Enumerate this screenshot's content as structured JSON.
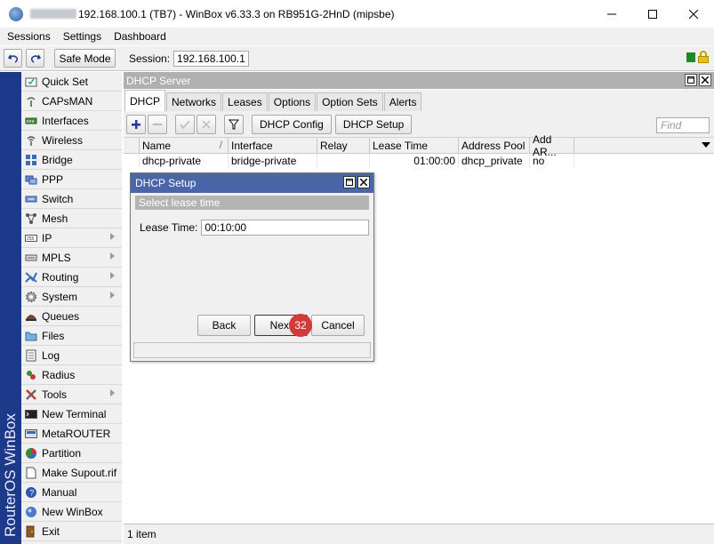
{
  "window": {
    "title": "192.168.100.1 (TB7) - WinBox v6.33.3 on RB951G-2HnD (mipsbe)"
  },
  "menubar": {
    "items": [
      "Sessions",
      "Settings",
      "Dashboard"
    ]
  },
  "toolbar": {
    "safe_mode_label": "Safe Mode",
    "session_label": "Session:",
    "session_value": "192.168.100.1"
  },
  "sidebar": {
    "brand": "RouterOS WinBox",
    "items": [
      {
        "label": "Quick Set",
        "icon": "quickset-icon",
        "submenu": false
      },
      {
        "label": "CAPsMAN",
        "icon": "capsman-icon",
        "submenu": false
      },
      {
        "label": "Interfaces",
        "icon": "interfaces-icon",
        "submenu": false
      },
      {
        "label": "Wireless",
        "icon": "wireless-icon",
        "submenu": false
      },
      {
        "label": "Bridge",
        "icon": "bridge-icon",
        "submenu": false
      },
      {
        "label": "PPP",
        "icon": "ppp-icon",
        "submenu": false
      },
      {
        "label": "Switch",
        "icon": "switch-icon",
        "submenu": false
      },
      {
        "label": "Mesh",
        "icon": "mesh-icon",
        "submenu": false
      },
      {
        "label": "IP",
        "icon": "ip-icon",
        "submenu": true
      },
      {
        "label": "MPLS",
        "icon": "mpls-icon",
        "submenu": true
      },
      {
        "label": "Routing",
        "icon": "routing-icon",
        "submenu": true
      },
      {
        "label": "System",
        "icon": "system-icon",
        "submenu": true
      },
      {
        "label": "Queues",
        "icon": "queues-icon",
        "submenu": false
      },
      {
        "label": "Files",
        "icon": "files-icon",
        "submenu": false
      },
      {
        "label": "Log",
        "icon": "log-icon",
        "submenu": false
      },
      {
        "label": "Radius",
        "icon": "radius-icon",
        "submenu": false
      },
      {
        "label": "Tools",
        "icon": "tools-icon",
        "submenu": true
      },
      {
        "label": "New Terminal",
        "icon": "terminal-icon",
        "submenu": false
      },
      {
        "label": "MetaROUTER",
        "icon": "metarouter-icon",
        "submenu": false
      },
      {
        "label": "Partition",
        "icon": "partition-icon",
        "submenu": false
      },
      {
        "label": "Make Supout.rif",
        "icon": "supout-icon",
        "submenu": false
      },
      {
        "label": "Manual",
        "icon": "manual-icon",
        "submenu": false
      },
      {
        "label": "New WinBox",
        "icon": "winbox-icon",
        "submenu": false
      },
      {
        "label": "Exit",
        "icon": "exit-icon",
        "submenu": false
      }
    ]
  },
  "panel": {
    "title": "DHCP Server",
    "tabs": [
      "DHCP",
      "Networks",
      "Leases",
      "Options",
      "Option Sets",
      "Alerts"
    ],
    "active_tab": "DHCP",
    "actions": {
      "dhcp_config": "DHCP Config",
      "dhcp_setup": "DHCP Setup",
      "find_placeholder": "Find"
    },
    "columns": [
      "Name",
      "Interface",
      "Relay",
      "Lease Time",
      "Address Pool",
      "Add AR..."
    ],
    "rows": [
      {
        "name": "dhcp-private",
        "interface": "bridge-private",
        "relay": "",
        "lease_time": "01:00:00",
        "address_pool": "dhcp_private",
        "add_arp": "no"
      }
    ],
    "status": "1 item"
  },
  "dialog": {
    "title": "DHCP Setup",
    "subtitle": "Select lease time",
    "field_label": "Lease Time:",
    "field_value": "00:10:00",
    "back_label": "Back",
    "next_label": "Next",
    "cancel_label": "Cancel",
    "badge": "32"
  },
  "colors": {
    "sidebar_brand_bg": "#1d3a8a",
    "dialog_title_bg": "#4a66a8",
    "badge_bg": "#d33a3a"
  }
}
